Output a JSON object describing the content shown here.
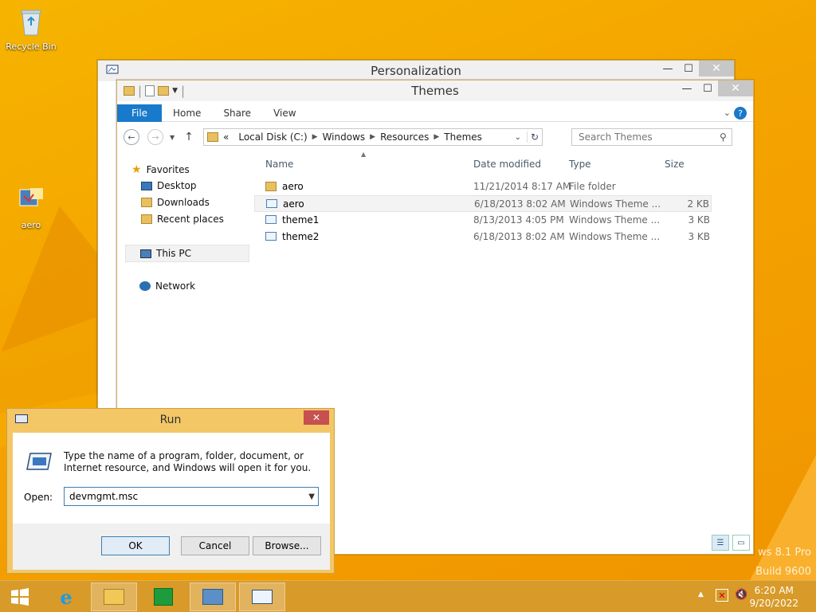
{
  "desktop": {
    "icons": [
      {
        "label": "Recycle Bin"
      },
      {
        "label": "aero"
      }
    ],
    "watermark_line1": "ws 8.1 Pro",
    "watermark_line2": "Build 9600"
  },
  "personalization": {
    "title": "Personalization"
  },
  "explorer": {
    "title": "Themes",
    "ribbon": {
      "file": "File",
      "tabs": [
        "Home",
        "Share",
        "View"
      ]
    },
    "address": {
      "prefix": "«",
      "crumbs": [
        "Local Disk (C:)",
        "Windows",
        "Resources",
        "Themes"
      ]
    },
    "search": {
      "placeholder": "Search Themes"
    },
    "nav": {
      "favorites": "Favorites",
      "favorites_items": [
        "Desktop",
        "Downloads",
        "Recent places"
      ],
      "this_pc": "This PC",
      "network": "Network"
    },
    "columns": {
      "name": "Name",
      "date": "Date modified",
      "type": "Type",
      "size": "Size"
    },
    "rows": [
      {
        "name": "aero",
        "date": "11/21/2014 8:17 AM",
        "type": "File folder",
        "size": "",
        "icon": "folder-icon"
      },
      {
        "name": "aero",
        "date": "6/18/2013 8:02 AM",
        "type": "Windows Theme ...",
        "size": "2 KB",
        "icon": "theme-file-icon"
      },
      {
        "name": "theme1",
        "date": "8/13/2013 4:05 PM",
        "type": "Windows Theme ...",
        "size": "3 KB",
        "icon": "theme-file-icon"
      },
      {
        "name": "theme2",
        "date": "6/18/2013 8:02 AM",
        "type": "Windows Theme ...",
        "size": "3 KB",
        "icon": "theme-file-icon"
      }
    ]
  },
  "run": {
    "title": "Run",
    "description": "Type the name of a program, folder, document, or Internet resource, and Windows will open it for you.",
    "open_label": "Open:",
    "open_value": "devmgmt.msc",
    "ok": "OK",
    "cancel": "Cancel",
    "browse": "Browse..."
  },
  "taskbar": {
    "time": "6:20 AM",
    "date": "9/20/2022"
  },
  "colors": {
    "accent_blue": "#1979ca",
    "desktop_orange": "#f4a300",
    "close_red": "#c75050"
  }
}
